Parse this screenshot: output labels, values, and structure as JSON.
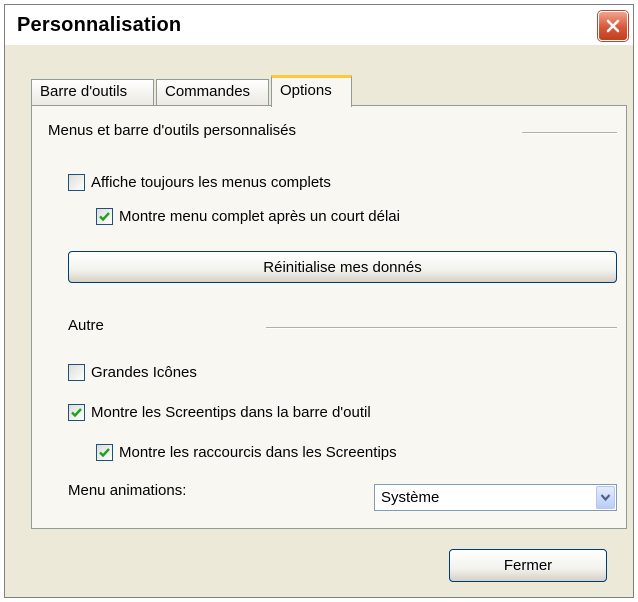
{
  "window": {
    "title": "Personnalisation"
  },
  "tabs": [
    {
      "label": "Barre d'outils",
      "active": false
    },
    {
      "label": "Commandes",
      "active": false
    },
    {
      "label": "Options",
      "active": true
    }
  ],
  "options": {
    "group_menus": "Menus et barre d'outils personnalisés",
    "always_full_menus": {
      "label": "Affiche toujours les menus complets",
      "checked": false
    },
    "full_menu_after_delay": {
      "label": "Montre menu complet après un court délai",
      "checked": true
    },
    "reset_button": "Réinitialise mes donnés",
    "group_other": "Autre",
    "large_icons": {
      "label": "Grandes Icônes",
      "checked": false
    },
    "show_screentips": {
      "label": "Montre les Screentips dans la barre d'outil",
      "checked": true
    },
    "show_shortcuts": {
      "label": "Montre les raccourcis dans les Screentips",
      "checked": true
    },
    "menu_animations": {
      "label": "Menu animations:",
      "value": "Système"
    }
  },
  "footer": {
    "close_button": "Fermer"
  },
  "colors": {
    "active_tab_accent": "#ffc73c",
    "checkmark": "#21a121",
    "close_button": "#d8573a"
  },
  "icons": {
    "close": "close-x-icon",
    "check": "checkmark-icon",
    "dropdown": "chevron-down-icon"
  }
}
